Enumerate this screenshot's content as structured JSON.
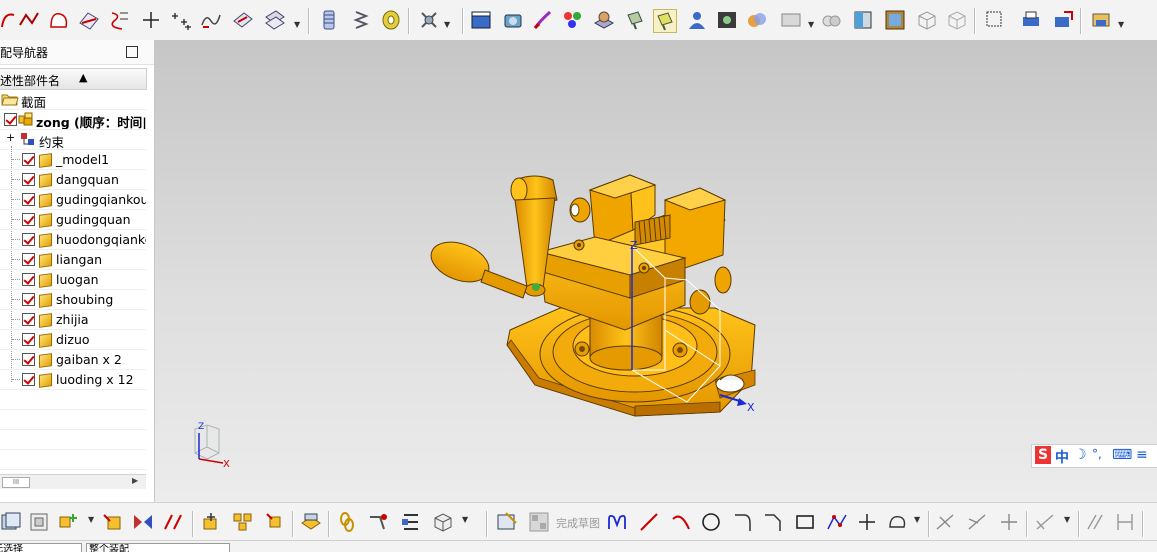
{
  "navigator": {
    "title": "配导航器",
    "column_header": "述性部件名",
    "sort_arrow": "▲",
    "section_label": "截面",
    "assembly_root": "zong (顺序：时间|",
    "constraints_label": "约束",
    "parts": [
      "_model1",
      "dangquan",
      "gudingqiankou",
      "gudingquan",
      "huodongqianko",
      "liangan",
      "luogan",
      "shoubing",
      "zhijia",
      "dizuo",
      "gaiban x 2",
      "luoding x 12"
    ],
    "scrollbar_thumb": "III"
  },
  "viewport": {
    "triad_x": "X",
    "triad_z": "Z",
    "corner_triad_x": "X",
    "corner_triad_z": "Z"
  },
  "ime_bar": {
    "logo": "S",
    "mode": "中",
    "moon": "☽",
    "punct": "°,",
    "keyboard": "⌨",
    "more": "≡"
  },
  "bottom_toolbar": {
    "finish_sketch_label": "完成草图"
  },
  "status_bar": {
    "field1": "无选择",
    "field2": "整个装配"
  },
  "colors": {
    "part_orange": "#f5a800",
    "part_edge": "#5a3a00",
    "checkbox_red": "#d40000",
    "triad_blue": "#1a2bd6"
  }
}
